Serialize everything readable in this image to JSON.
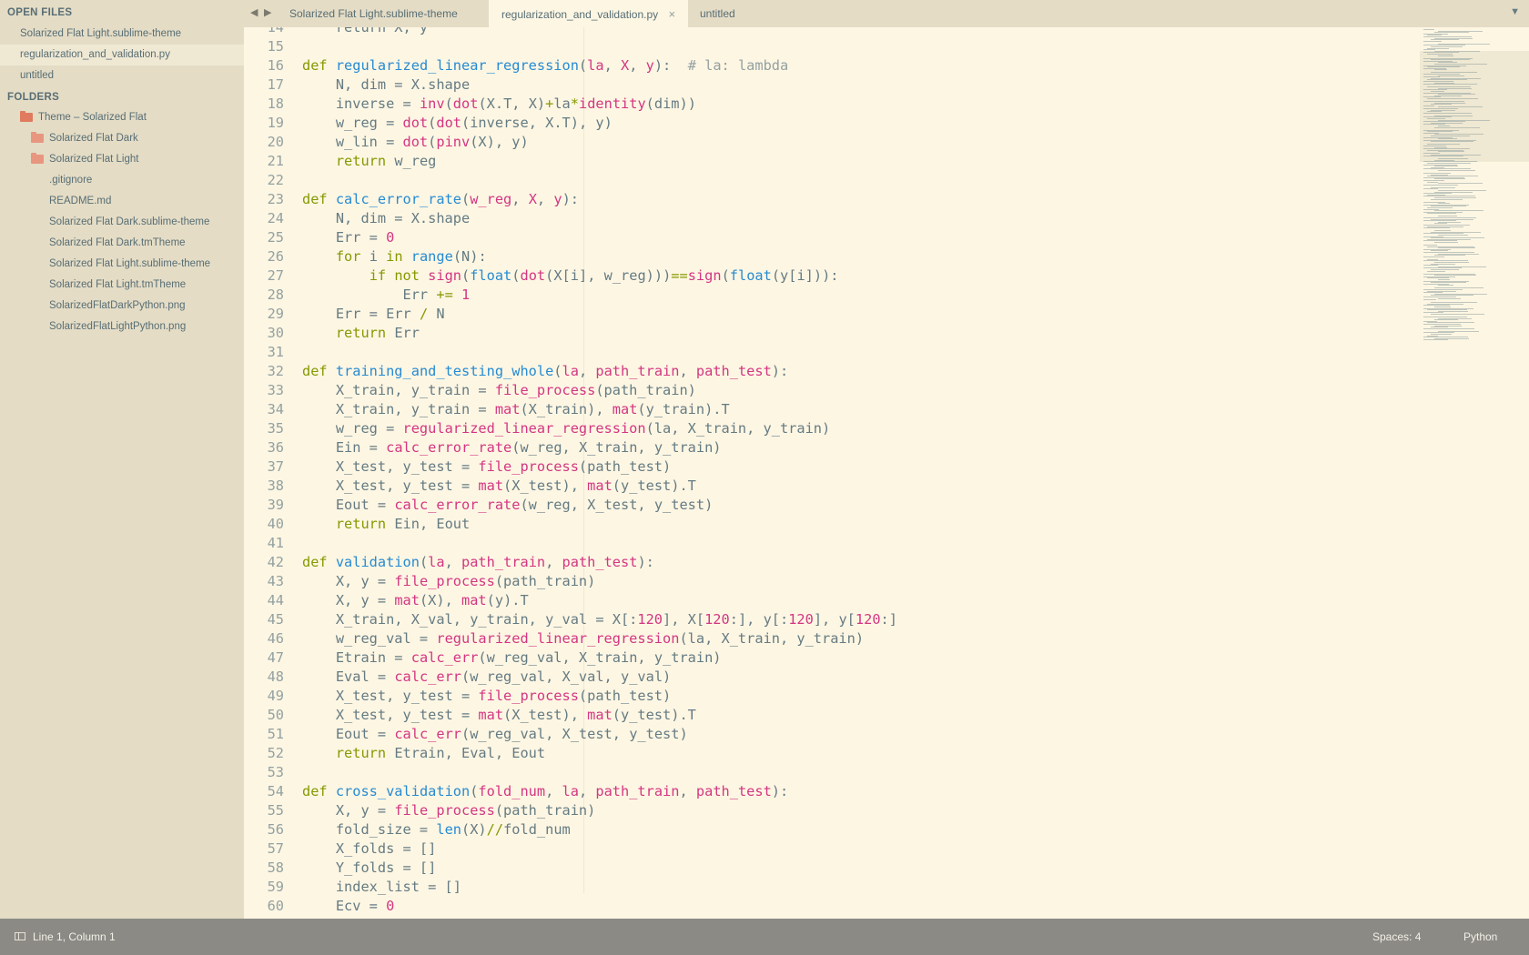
{
  "sidebar": {
    "open_files_header": "OPEN FILES",
    "open_files": [
      {
        "label": "Solarized Flat Light.sublime-theme",
        "active": false
      },
      {
        "label": "regularization_and_validation.py",
        "active": true
      },
      {
        "label": "untitled",
        "active": false
      }
    ],
    "folders_header": "FOLDERS",
    "root_folder": "Theme – Solarized Flat",
    "subfolders": [
      "Solarized Flat Dark",
      "Solarized Flat Light"
    ],
    "files": [
      ".gitignore",
      "README.md",
      "Solarized Flat Dark.sublime-theme",
      "Solarized Flat Dark.tmTheme",
      "Solarized Flat Light.sublime-theme",
      "Solarized Flat Light.tmTheme",
      "SolarizedFlatDarkPython.png",
      "SolarizedFlatLightPython.png"
    ]
  },
  "tabs": [
    {
      "label": "Solarized Flat Light.sublime-theme",
      "active": false,
      "closable": false
    },
    {
      "label": "regularization_and_validation.py",
      "active": true,
      "closable": true
    },
    {
      "label": "untitled",
      "active": false,
      "closable": false
    }
  ],
  "icons": {
    "nav_left": "◀",
    "nav_right": "▶",
    "tab_close": "×",
    "tab_dropdown": "▼",
    "status_panel": "panel-toggle-icon"
  },
  "colors": {
    "background": "#fdf6e3",
    "sidebar": "#e4dcc5",
    "keyword": "#859900",
    "function": "#268bd2",
    "param_and_number": "#d33682",
    "comment": "#93a1a1",
    "statusbar": "#8b8a85"
  },
  "code": {
    "first_line_number": 14,
    "lines": [
      [
        [
          "t",
          "    return X, y"
        ]
      ],
      [],
      [
        [
          "kw",
          "def "
        ],
        [
          "fn",
          "regularized_linear_regression"
        ],
        [
          "t",
          "("
        ],
        [
          "param",
          "la"
        ],
        [
          "t",
          ", "
        ],
        [
          "param",
          "X"
        ],
        [
          "t",
          ", "
        ],
        [
          "param",
          "y"
        ],
        [
          "t",
          "):  "
        ],
        [
          "cm",
          "# la: lambda"
        ]
      ],
      [
        [
          "t",
          "    N, dim = X.shape"
        ]
      ],
      [
        [
          "t",
          "    inverse = "
        ],
        [
          "call",
          "inv"
        ],
        [
          "t",
          "("
        ],
        [
          "call",
          "dot"
        ],
        [
          "t",
          "(X.T, X)"
        ],
        [
          "op",
          "+"
        ],
        [
          "t",
          "la"
        ],
        [
          "op",
          "*"
        ],
        [
          "call",
          "identity"
        ],
        [
          "t",
          "(dim))"
        ]
      ],
      [
        [
          "t",
          "    w_reg = "
        ],
        [
          "call",
          "dot"
        ],
        [
          "t",
          "("
        ],
        [
          "call",
          "dot"
        ],
        [
          "t",
          "(inverse, X.T), y)"
        ]
      ],
      [
        [
          "t",
          "    w_lin = "
        ],
        [
          "call",
          "dot"
        ],
        [
          "t",
          "("
        ],
        [
          "call",
          "pinv"
        ],
        [
          "t",
          "(X), y)"
        ]
      ],
      [
        [
          "t",
          "    "
        ],
        [
          "kw",
          "return"
        ],
        [
          "t",
          " w_reg"
        ]
      ],
      [],
      [
        [
          "kw",
          "def "
        ],
        [
          "fn",
          "calc_error_rate"
        ],
        [
          "t",
          "("
        ],
        [
          "param",
          "w_reg"
        ],
        [
          "t",
          ", "
        ],
        [
          "param",
          "X"
        ],
        [
          "t",
          ", "
        ],
        [
          "param",
          "y"
        ],
        [
          "t",
          "):"
        ]
      ],
      [
        [
          "t",
          "    N, dim = X.shape"
        ]
      ],
      [
        [
          "t",
          "    Err = "
        ],
        [
          "num",
          "0"
        ]
      ],
      [
        [
          "t",
          "    "
        ],
        [
          "kw",
          "for"
        ],
        [
          "t",
          " i "
        ],
        [
          "kw",
          "in"
        ],
        [
          "t",
          " "
        ],
        [
          "bi",
          "range"
        ],
        [
          "t",
          "(N):"
        ]
      ],
      [
        [
          "t",
          "        "
        ],
        [
          "kw",
          "if not "
        ],
        [
          "call",
          "sign"
        ],
        [
          "t",
          "("
        ],
        [
          "bi",
          "float"
        ],
        [
          "t",
          "("
        ],
        [
          "call",
          "dot"
        ],
        [
          "t",
          "(X[i], w_reg)))"
        ],
        [
          "op",
          "=="
        ],
        [
          "call",
          "sign"
        ],
        [
          "t",
          "("
        ],
        [
          "bi",
          "float"
        ],
        [
          "t",
          "(y[i])):"
        ]
      ],
      [
        [
          "t",
          "            Err "
        ],
        [
          "op",
          "+="
        ],
        [
          "t",
          " "
        ],
        [
          "num",
          "1"
        ]
      ],
      [
        [
          "t",
          "    Err = Err "
        ],
        [
          "op",
          "/"
        ],
        [
          "t",
          " N"
        ]
      ],
      [
        [
          "t",
          "    "
        ],
        [
          "kw",
          "return"
        ],
        [
          "t",
          " Err"
        ]
      ],
      [],
      [
        [
          "kw",
          "def "
        ],
        [
          "fn",
          "training_and_testing_whole"
        ],
        [
          "t",
          "("
        ],
        [
          "param",
          "la"
        ],
        [
          "t",
          ", "
        ],
        [
          "param",
          "path_train"
        ],
        [
          "t",
          ", "
        ],
        [
          "param",
          "path_test"
        ],
        [
          "t",
          "):"
        ]
      ],
      [
        [
          "t",
          "    X_train, y_train = "
        ],
        [
          "call",
          "file_process"
        ],
        [
          "t",
          "(path_train)"
        ]
      ],
      [
        [
          "t",
          "    X_train, y_train = "
        ],
        [
          "call",
          "mat"
        ],
        [
          "t",
          "(X_train), "
        ],
        [
          "call",
          "mat"
        ],
        [
          "t",
          "(y_train).T"
        ]
      ],
      [
        [
          "t",
          "    w_reg = "
        ],
        [
          "call",
          "regularized_linear_regression"
        ],
        [
          "t",
          "(la, X_train, y_train)"
        ]
      ],
      [
        [
          "t",
          "    Ein = "
        ],
        [
          "call",
          "calc_error_rate"
        ],
        [
          "t",
          "(w_reg, X_train, y_train)"
        ]
      ],
      [
        [
          "t",
          "    X_test, y_test = "
        ],
        [
          "call",
          "file_process"
        ],
        [
          "t",
          "(path_test)"
        ]
      ],
      [
        [
          "t",
          "    X_test, y_test = "
        ],
        [
          "call",
          "mat"
        ],
        [
          "t",
          "(X_test), "
        ],
        [
          "call",
          "mat"
        ],
        [
          "t",
          "(y_test).T"
        ]
      ],
      [
        [
          "t",
          "    Eout = "
        ],
        [
          "call",
          "calc_error_rate"
        ],
        [
          "t",
          "(w_reg, X_test, y_test)"
        ]
      ],
      [
        [
          "t",
          "    "
        ],
        [
          "kw",
          "return"
        ],
        [
          "t",
          " Ein, Eout"
        ]
      ],
      [],
      [
        [
          "kw",
          "def "
        ],
        [
          "fn",
          "validation"
        ],
        [
          "t",
          "("
        ],
        [
          "param",
          "la"
        ],
        [
          "t",
          ", "
        ],
        [
          "param",
          "path_train"
        ],
        [
          "t",
          ", "
        ],
        [
          "param",
          "path_test"
        ],
        [
          "t",
          "):"
        ]
      ],
      [
        [
          "t",
          "    X, y = "
        ],
        [
          "call",
          "file_process"
        ],
        [
          "t",
          "(path_train)"
        ]
      ],
      [
        [
          "t",
          "    X, y = "
        ],
        [
          "call",
          "mat"
        ],
        [
          "t",
          "(X), "
        ],
        [
          "call",
          "mat"
        ],
        [
          "t",
          "(y).T"
        ]
      ],
      [
        [
          "t",
          "    X_train, X_val, y_train, y_val = X[:"
        ],
        [
          "num",
          "120"
        ],
        [
          "t",
          "], X["
        ],
        [
          "num",
          "120"
        ],
        [
          "t",
          ":], y[:"
        ],
        [
          "num",
          "120"
        ],
        [
          "t",
          "], y["
        ],
        [
          "num",
          "120"
        ],
        [
          "t",
          ":]"
        ]
      ],
      [
        [
          "t",
          "    w_reg_val = "
        ],
        [
          "call",
          "regularized_linear_regression"
        ],
        [
          "t",
          "(la, X_train, y_train)"
        ]
      ],
      [
        [
          "t",
          "    Etrain = "
        ],
        [
          "call",
          "calc_err"
        ],
        [
          "t",
          "(w_reg_val, X_train, y_train)"
        ]
      ],
      [
        [
          "t",
          "    Eval = "
        ],
        [
          "call",
          "calc_err"
        ],
        [
          "t",
          "(w_reg_val, X_val, y_val)"
        ]
      ],
      [
        [
          "t",
          "    X_test, y_test = "
        ],
        [
          "call",
          "file_process"
        ],
        [
          "t",
          "(path_test)"
        ]
      ],
      [
        [
          "t",
          "    X_test, y_test = "
        ],
        [
          "call",
          "mat"
        ],
        [
          "t",
          "(X_test), "
        ],
        [
          "call",
          "mat"
        ],
        [
          "t",
          "(y_test).T"
        ]
      ],
      [
        [
          "t",
          "    Eout = "
        ],
        [
          "call",
          "calc_err"
        ],
        [
          "t",
          "(w_reg_val, X_test, y_test)"
        ]
      ],
      [
        [
          "t",
          "    "
        ],
        [
          "kw",
          "return"
        ],
        [
          "t",
          " Etrain, Eval, Eout"
        ]
      ],
      [],
      [
        [
          "kw",
          "def "
        ],
        [
          "fn",
          "cross_validation"
        ],
        [
          "t",
          "("
        ],
        [
          "param",
          "fold_num"
        ],
        [
          "t",
          ", "
        ],
        [
          "param",
          "la"
        ],
        [
          "t",
          ", "
        ],
        [
          "param",
          "path_train"
        ],
        [
          "t",
          ", "
        ],
        [
          "param",
          "path_test"
        ],
        [
          "t",
          "):"
        ]
      ],
      [
        [
          "t",
          "    X, y = "
        ],
        [
          "call",
          "file_process"
        ],
        [
          "t",
          "(path_train)"
        ]
      ],
      [
        [
          "t",
          "    fold_size = "
        ],
        [
          "bi",
          "len"
        ],
        [
          "t",
          "(X)"
        ],
        [
          "op",
          "//"
        ],
        [
          "t",
          "fold_num"
        ]
      ],
      [
        [
          "t",
          "    X_folds = []"
        ]
      ],
      [
        [
          "t",
          "    Y_folds = []"
        ]
      ],
      [
        [
          "t",
          "    index_list = []"
        ]
      ],
      [
        [
          "t",
          "    Ecv = "
        ],
        [
          "num",
          "0"
        ]
      ]
    ]
  },
  "status": {
    "position": "Line 1, Column 1",
    "indent": "Spaces: 4",
    "syntax": "Python"
  }
}
